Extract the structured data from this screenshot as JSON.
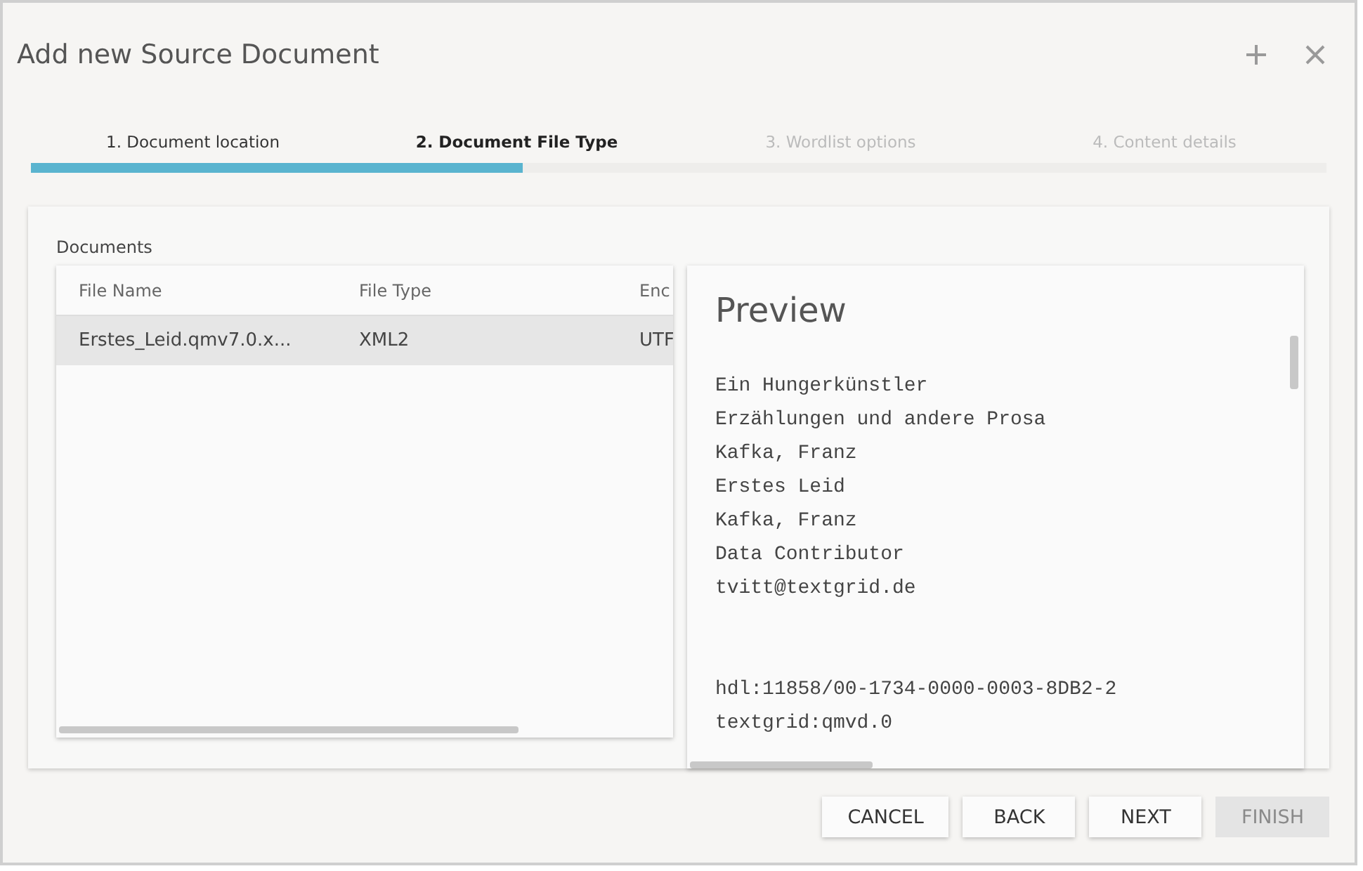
{
  "window": {
    "title": "Add new Source Document"
  },
  "steps": [
    {
      "label": "1. Document location",
      "selected": false,
      "disabled": false
    },
    {
      "label": "2. Document File Type",
      "selected": true,
      "disabled": false
    },
    {
      "label": "3. Wordlist options",
      "selected": false,
      "disabled": true
    },
    {
      "label": "4. Content details",
      "selected": false,
      "disabled": true
    }
  ],
  "progress": {
    "level": 0.38
  },
  "documents": {
    "label": "Documents",
    "columns": [
      "File Name",
      "File Type",
      "Enc"
    ],
    "rows": [
      {
        "cells": [
          "Erstes_Leid.qmv7.0.x...",
          "XML2",
          "UTF"
        ],
        "selected": true
      }
    ]
  },
  "preview": {
    "title": "Preview",
    "blocks": [
      [
        "Ein Hungerkünstler",
        "Erzählungen und andere Prosa",
        "Kafka, Franz",
        "Erstes Leid",
        "Kafka, Franz",
        "Data Contributor",
        "tvitt@textgrid.de"
      ],
      [
        "hdl:11858/00-1734-0000-0003-8DB2-2",
        "textgrid:qmvd.0"
      ]
    ]
  },
  "buttons": [
    {
      "label": "CANCEL",
      "disabled": false
    },
    {
      "label": "BACK",
      "disabled": false
    },
    {
      "label": "NEXT",
      "disabled": false
    },
    {
      "label": "FINISH",
      "disabled": true
    }
  ]
}
